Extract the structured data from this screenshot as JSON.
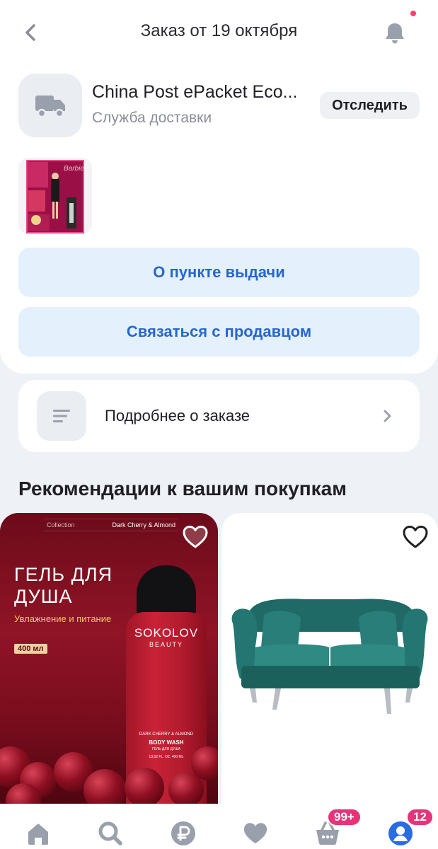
{
  "header": {
    "title": "Заказ от 19 октября",
    "back_icon": "chevron-left-icon",
    "bell_icon": "bell-icon",
    "notification_dot_color": "#ff3d6e"
  },
  "delivery": {
    "name": "China Post ePacket Eco...",
    "subtitle": "Служба доставки",
    "track_label": "Отследить",
    "icon": "truck-icon"
  },
  "product": {
    "thumbnail_text": "Barbie"
  },
  "actions": {
    "pickup_label": "О пункте выдачи",
    "contact_label": "Связаться с продавцом",
    "accent_color": "#2866cf",
    "background_color": "#e4f1fc"
  },
  "details": {
    "label": "Подробнее о заказе",
    "icon": "list-icon",
    "chevron_icon": "chevron-right-icon"
  },
  "recommendations": {
    "title": "Рекомендации к вашим покупкам",
    "items": [
      {
        "kind": "shower-gel",
        "collection": "Collection",
        "flavor": "Dark Cherry & Almond",
        "title": "ГЕЛЬ ДЛЯ ДУША",
        "subtitle": "Увлажнение и питание",
        "volume": "400 мл",
        "brand": "SOKOLOV",
        "brand_sub": "BEAUTY",
        "label_line1": "DARK CHERRY & ALMOND",
        "label_line2": "BODY WASH",
        "label_line3": "ГЕЛЬ ДЛЯ ДУША",
        "label_line4": "13,52 FL. OZ. 400 ML",
        "favorite_icon": "heart-outline-icon"
      },
      {
        "kind": "sofa",
        "favorite_icon": "heart-outline-icon"
      }
    ]
  },
  "bottom_nav": {
    "items": [
      {
        "name": "home",
        "icon": "home-icon"
      },
      {
        "name": "search",
        "icon": "search-icon"
      },
      {
        "name": "finance",
        "icon": "ruble-icon"
      },
      {
        "name": "favorites",
        "icon": "heart-icon"
      },
      {
        "name": "cart",
        "icon": "cart-icon",
        "badge": "99+"
      },
      {
        "name": "profile",
        "icon": "profile-icon",
        "badge": "12"
      }
    ],
    "active_color": "#2a6de0",
    "inactive_color": "#9aa0ab",
    "badge_color": "#e8327a"
  }
}
